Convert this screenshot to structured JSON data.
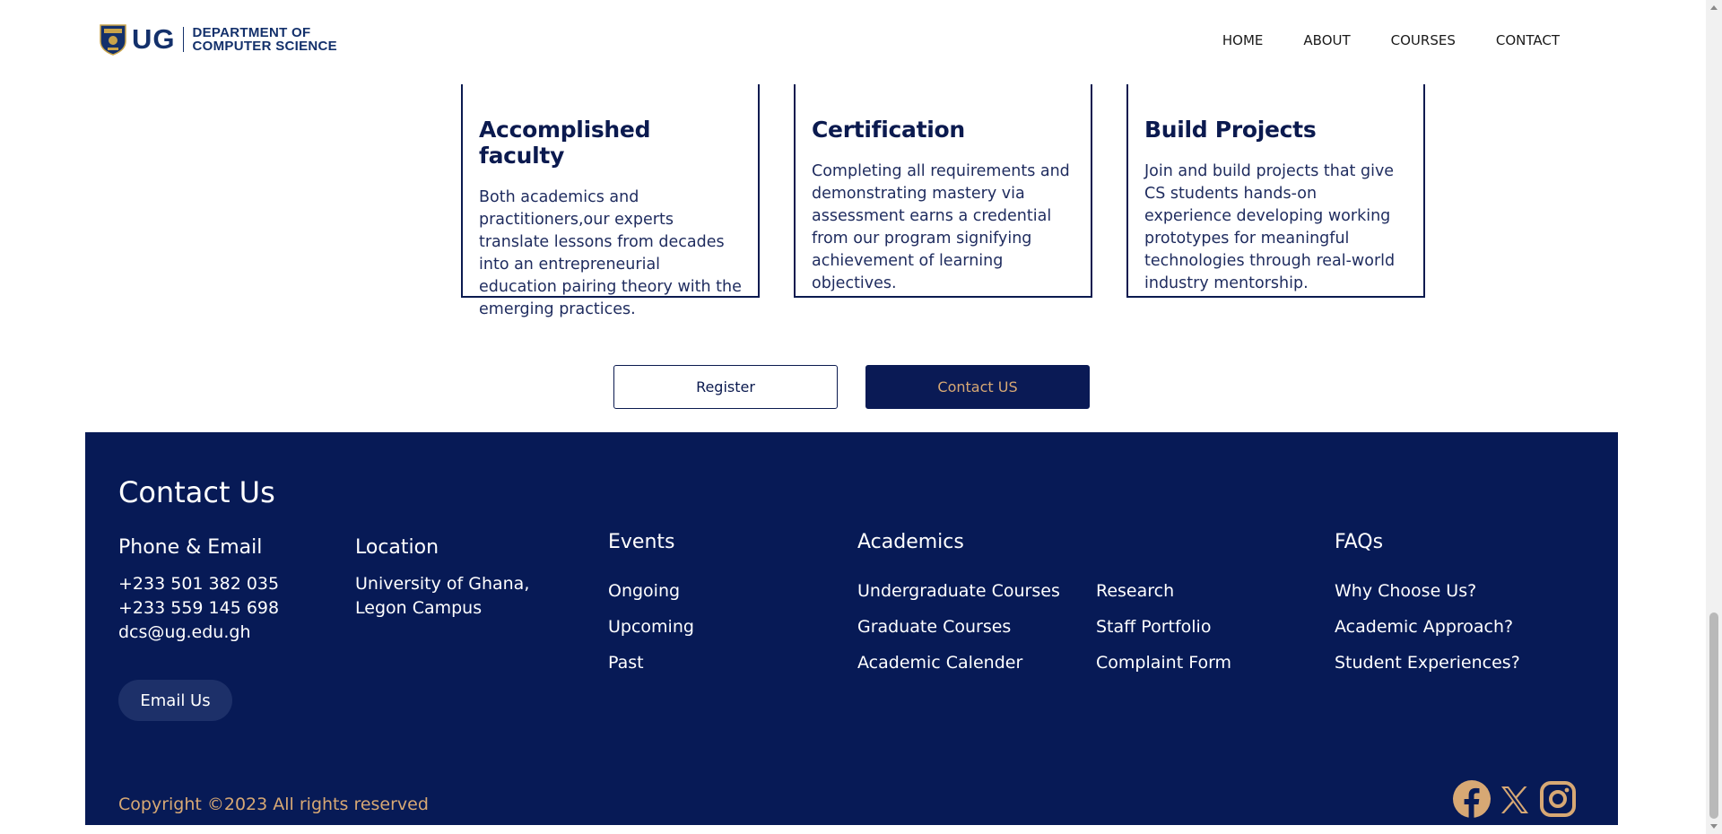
{
  "header": {
    "logo_mark": "UG",
    "dept_line1": "DEPARTMENT OF",
    "dept_line2": "COMPUTER SCIENCE",
    "nav": [
      "HOME",
      "ABOUT",
      "COURSES",
      "CONTACT"
    ]
  },
  "features": [
    {
      "title": "Accomplished faculty",
      "text": "Both academics and practitioners,our experts translate lessons from decades into an entrepreneurial education pairing theory with the emerging practices."
    },
    {
      "title": "Certification",
      "text": "Completing all requirements and demonstrating mastery via assessment earns a credential from our program signifying achievement of learning objectives."
    },
    {
      "title": "Build Projects",
      "text": "Join and build projects that give CS students hands-on experience developing working prototypes for meaningful technologies through real-world industry mentorship."
    }
  ],
  "actions": {
    "register_label": "Register",
    "contact_label": "Contact US"
  },
  "footer": {
    "title": "Contact Us",
    "phone_email": {
      "heading": "Phone & Email",
      "phone1": "+233 501 382 035",
      "phone2": "+233 559 145 698",
      "email": "dcs@ug.edu.gh",
      "button_label": "Email Us"
    },
    "location": {
      "heading": "Location",
      "line1": "University of Ghana,",
      "line2": "Legon Campus"
    },
    "events": {
      "heading": "Events",
      "links": [
        "Ongoing",
        "Upcoming",
        "Past"
      ]
    },
    "academics": {
      "heading": "Academics",
      "links_col1": [
        "Undergraduate Courses",
        "Graduate Courses",
        "Academic Calender"
      ],
      "links_col2": [
        "Research",
        "Staff Portfolio",
        "Complaint Form"
      ]
    },
    "faqs": {
      "heading": "FAQs",
      "links": [
        "Why Choose Us?",
        "Academic Approach?",
        "Student Experiences?"
      ]
    },
    "copyright": "Copyright ©2023 All rights reserved",
    "social_icons": [
      "facebook-icon",
      "x-icon",
      "instagram-icon"
    ]
  },
  "colors": {
    "navy": "#071a56",
    "gold": "#d7a874",
    "email_button": "#1d3069"
  }
}
